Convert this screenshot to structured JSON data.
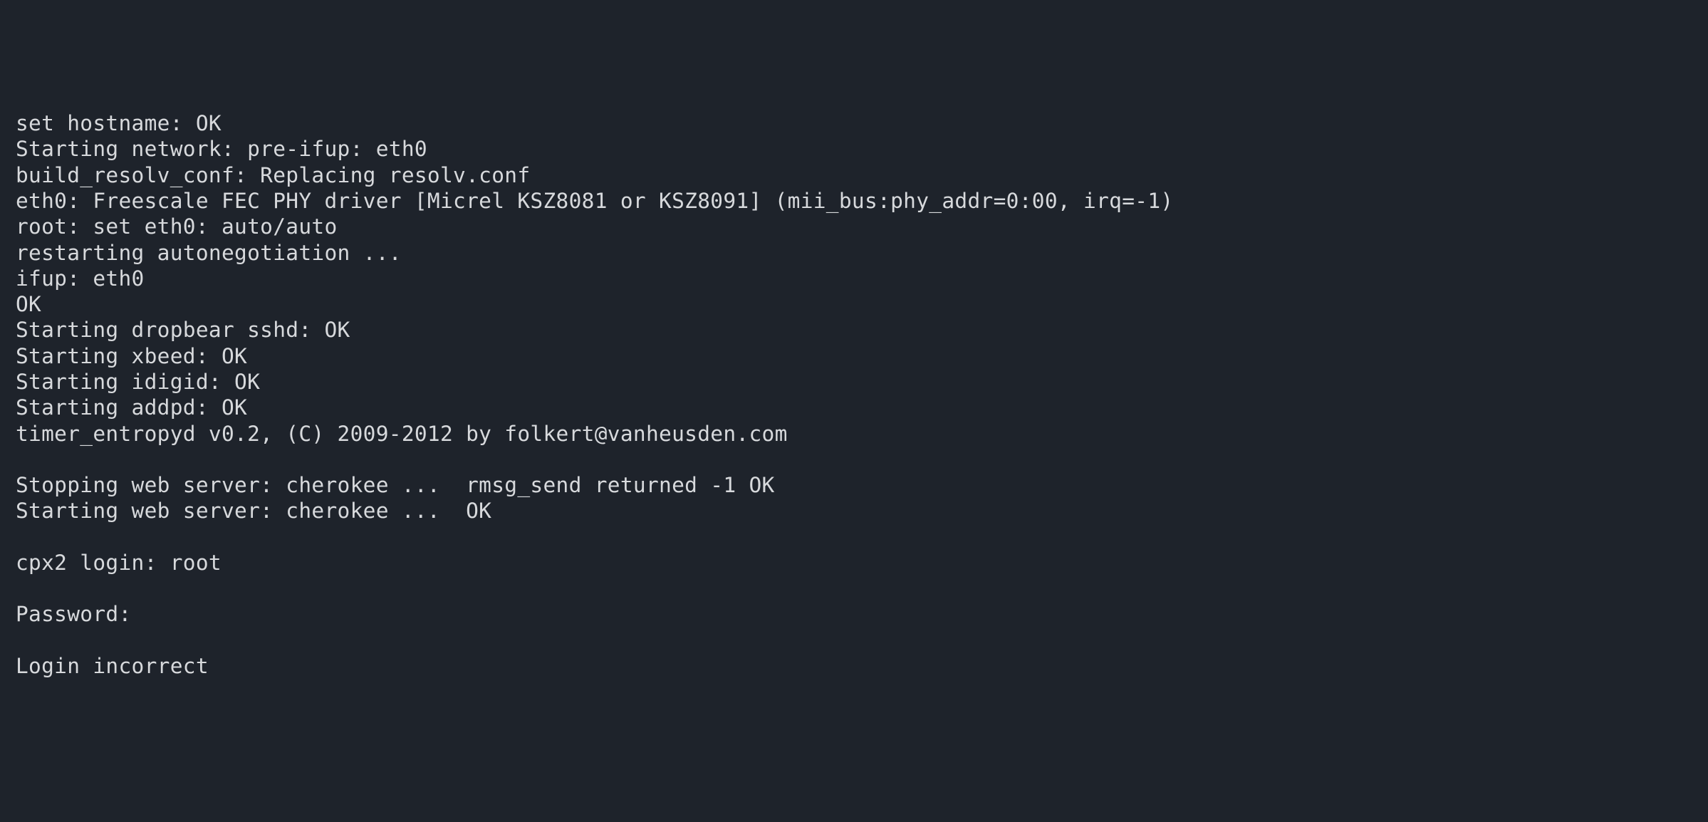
{
  "terminal": {
    "lines": [
      "set hostname: OK",
      "Starting network: pre-ifup: eth0",
      "build_resolv_conf: Replacing resolv.conf",
      "eth0: Freescale FEC PHY driver [Micrel KSZ8081 or KSZ8091] (mii_bus:phy_addr=0:00, irq=-1)",
      "root: set eth0: auto/auto",
      "restarting autonegotiation ...",
      "ifup: eth0",
      "OK",
      "Starting dropbear sshd: OK",
      "Starting xbeed: OK",
      "Starting idigid: OK",
      "Starting addpd: OK",
      "timer_entropyd v0.2, (C) 2009-2012 by folkert@vanheusden.com",
      "",
      "Stopping web server: cherokee ...  rmsg_send returned -1 OK",
      "Starting web server: cherokee ...  OK",
      "",
      "cpx2 login: root",
      "",
      "Password:",
      "",
      "Login incorrect"
    ]
  }
}
